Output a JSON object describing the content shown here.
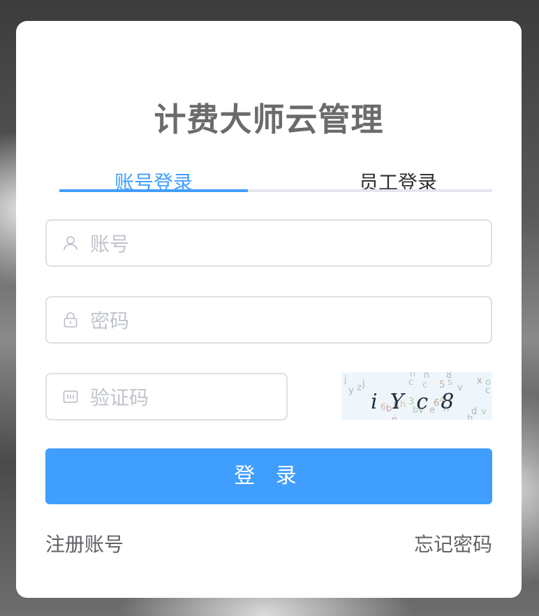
{
  "title": "计费大师云管理",
  "tabs": [
    {
      "label": "账号登录",
      "active": true
    },
    {
      "label": "员工登录",
      "active": false
    }
  ],
  "fields": {
    "account": {
      "placeholder": "账号",
      "value": "",
      "icon": "user-icon"
    },
    "password": {
      "placeholder": "密码",
      "value": "",
      "icon": "lock-icon"
    },
    "captcha": {
      "placeholder": "验证码",
      "value": "",
      "icon": "captcha-code-icon"
    }
  },
  "captcha_image": {
    "text": "iYc8"
  },
  "login_button": "登 录",
  "links": {
    "register": "注册账号",
    "forgot": "忘记密码"
  },
  "colors": {
    "accent": "#409eff",
    "title": "#6b6b6b",
    "border": "#dcdfe6",
    "placeholder": "#c0c4cc"
  }
}
